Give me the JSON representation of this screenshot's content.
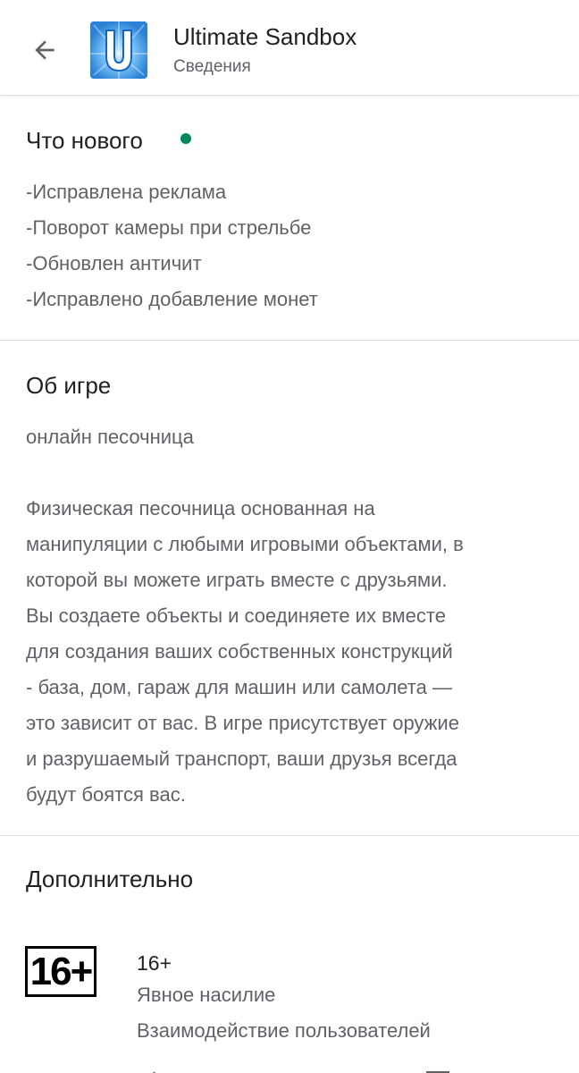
{
  "header": {
    "title": "Ultimate Sandbox",
    "subtitle": "Сведения",
    "back_icon": "arrow-left-icon",
    "app_icon": "ultimate-sandbox-app-icon",
    "app_icon_letter": "U"
  },
  "whats_new": {
    "title": "Что нового",
    "indicator_color": "#01875f",
    "items": [
      "-Исправлена реклама",
      "-Поворот камеры при стрельбе",
      "-Обновлен античит",
      "-Исправлено добавление монет"
    ]
  },
  "about": {
    "title": "Об игре",
    "tagline": "онлайн песочница",
    "description_lines": [
      "Физическая песочница основанная на",
      "манипуляции с любыми игровыми объектами, в",
      "которой вы можете играть вместе с друзьями.",
      "Вы создаете объекты и соединяете их вместе",
      "для создания ваших собственных конструкций",
      "- база, дом, гараж для машин или самолета —",
      "это зависит от вас. В игре присутствует оружие",
      "и разрушаемый транспорт, ваши друзья всегда",
      "будут боятся вас."
    ]
  },
  "additional": {
    "title": "Дополнительно",
    "rating": {
      "badge": "16+",
      "age": "16+",
      "descriptors": [
        "Явное насилие",
        "Взаимодействие пользователей"
      ]
    }
  },
  "colors": {
    "primary_text": "#202124",
    "secondary_text": "#5f6368",
    "divider": "#dadce0",
    "app_icon_bg": "#2f8fdc"
  }
}
